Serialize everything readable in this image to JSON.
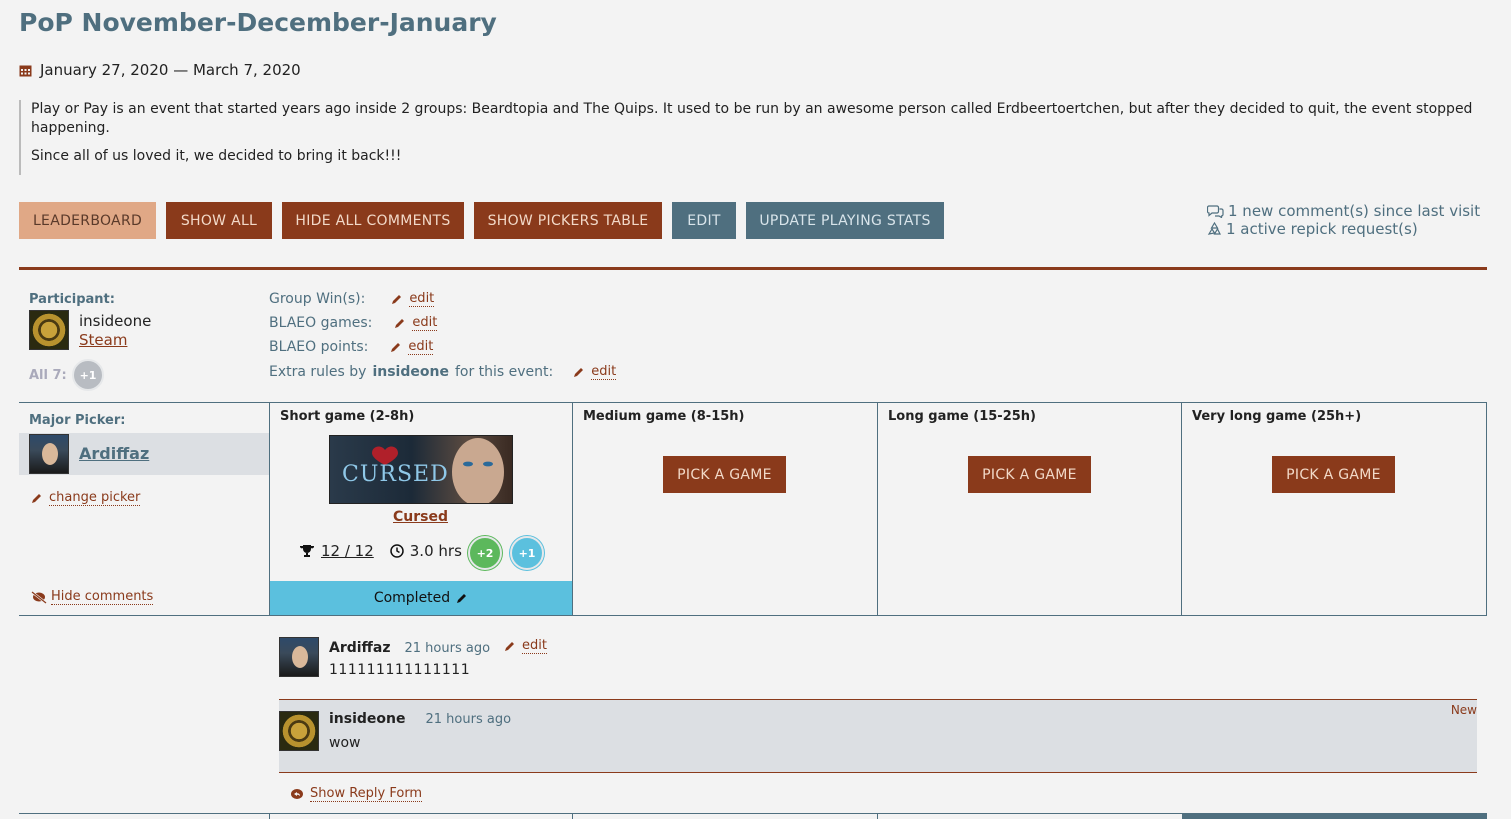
{
  "page": {
    "title": "PoP November-December-January",
    "dates": "January 27, 2020 — March 7, 2020",
    "description": [
      "Play or Pay is an event that started years ago inside 2 groups: Beardtopia and The Quips. It used to be run by an awesome person called Erdbeertoertchen, but after they decided to quit, the event stopped happening.",
      "Since all of us loved it, we decided to bring it back!!!"
    ]
  },
  "toolbar": {
    "leaderboard": "LEADERBOARD",
    "show_all": "SHOW ALL",
    "hide_all_comments": "HIDE ALL COMMENTS",
    "show_pickers_table": "SHOW PICKERS TABLE",
    "edit": "EDIT",
    "update_playing_stats": "UPDATE PLAYING STATS"
  },
  "notices": {
    "new_comments": "1 new comment(s) since last visit",
    "repick_requests": "1 active repick request(s)"
  },
  "participant": {
    "label": "Participant:",
    "name": "insideone",
    "profile_link": "Steam",
    "all_label": "All 7:",
    "all_badge": "+1"
  },
  "meta": {
    "group_wins": "Group Win(s):",
    "blaeo_games": "BLAEO games:",
    "blaeo_points": "BLAEO points:",
    "extra_rules_prefix": "Extra rules by",
    "extra_rules_user": "insideone",
    "extra_rules_suffix": "for this event:",
    "edit": "edit"
  },
  "picker": {
    "label": "Major Picker:",
    "name": "Ardiffaz",
    "change": "change picker",
    "hide_comments": "Hide comments"
  },
  "columns": [
    {
      "head": "Short game (2-8h)"
    },
    {
      "head": "Medium game (8-15h)",
      "action": "PICK A GAME"
    },
    {
      "head": "Long game (15-25h)",
      "action": "PICK A GAME"
    },
    {
      "head": "Very long game (25h+)",
      "action": "PICK A GAME"
    }
  ],
  "game": {
    "image_text": "CURSED",
    "title": "Cursed",
    "achievements": "12 / 12",
    "hours": "3.0 hrs",
    "badge_green": "+2",
    "badge_blue": "+1",
    "status": "Completed"
  },
  "comments": [
    {
      "author": "Ardiffaz",
      "time": "21 hours ago",
      "edit": "edit",
      "text": "111111111111111"
    },
    {
      "author": "insideone",
      "time": "21 hours ago",
      "text": "wow",
      "tag": "New"
    }
  ],
  "reply_form": "Show Reply Form",
  "colors": {
    "rust": "#8a3a1b",
    "slate": "#4f6f7f",
    "peach": "#e0a886",
    "completed": "#5bc0de",
    "badge_green": "#5cb85c",
    "badge_blue": "#5bc0de",
    "badge_grey": "#b8bcc2"
  }
}
